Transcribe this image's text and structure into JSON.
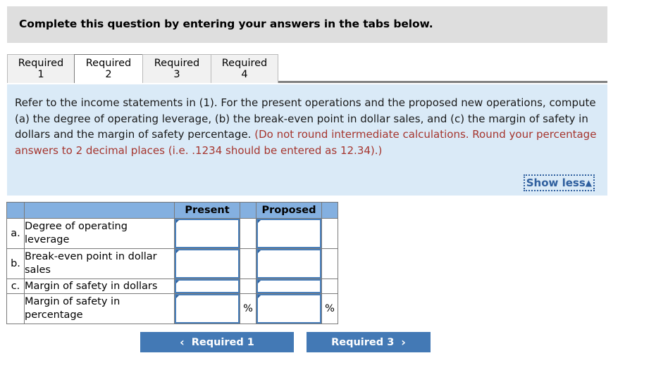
{
  "banner": {
    "title": "Complete this question by entering your answers in the tabs below."
  },
  "tabs": [
    {
      "line1": "Required",
      "line2": "1",
      "active": false
    },
    {
      "line1": "Required",
      "line2": "2",
      "active": true
    },
    {
      "line1": "Required",
      "line2": "3",
      "active": false
    },
    {
      "line1": "Required",
      "line2": "4",
      "active": false
    }
  ],
  "instructions": {
    "body": "Refer to the income statements in (1). For the present operations and the proposed new operations, compute (a) the degree of operating leverage, (b) the break-even point in dollar sales, and (c) the margin of safety in dollars and the margin of safety percentage. ",
    "note": "(Do not round intermediate calculations. Round your percentage answers to 2 decimal places (i.e. .1234 should be entered as 12.34).)",
    "show_less_label": "Show less",
    "show_less_caret": "▲"
  },
  "table": {
    "headers": {
      "blank_letter": "",
      "blank_label": "",
      "present": "Present",
      "present_unit": "",
      "proposed": "Proposed",
      "proposed_unit": ""
    },
    "rows": [
      {
        "letter": "a.",
        "label": "Degree of operating leverage",
        "present_value": "",
        "present_unit": "",
        "proposed_value": "",
        "proposed_unit": "",
        "tall": true
      },
      {
        "letter": "b.",
        "label": "Break-even point in dollar sales",
        "present_value": "",
        "present_unit": "",
        "proposed_value": "",
        "proposed_unit": "",
        "tall": true
      },
      {
        "letter": "c.",
        "label": "Margin of safety in dollars",
        "present_value": "",
        "present_unit": "",
        "proposed_value": "",
        "proposed_unit": "",
        "tall": false
      },
      {
        "letter": "",
        "label": "Margin of safety in percentage",
        "present_value": "",
        "present_unit": "%",
        "proposed_value": "",
        "proposed_unit": "%",
        "tall": true
      }
    ]
  },
  "nav": {
    "prev_label": "Required 1",
    "prev_chevron": "‹",
    "next_label": "Required 3",
    "next_chevron": "›"
  },
  "colors": {
    "banner_bg": "#dedede",
    "panel_bg": "#daeaf7",
    "note_text": "#a5352e",
    "table_header_bg": "#84b0e0",
    "input_border": "#4a7fba",
    "button_bg": "#4379b5",
    "link_text": "#2f5f9e"
  }
}
